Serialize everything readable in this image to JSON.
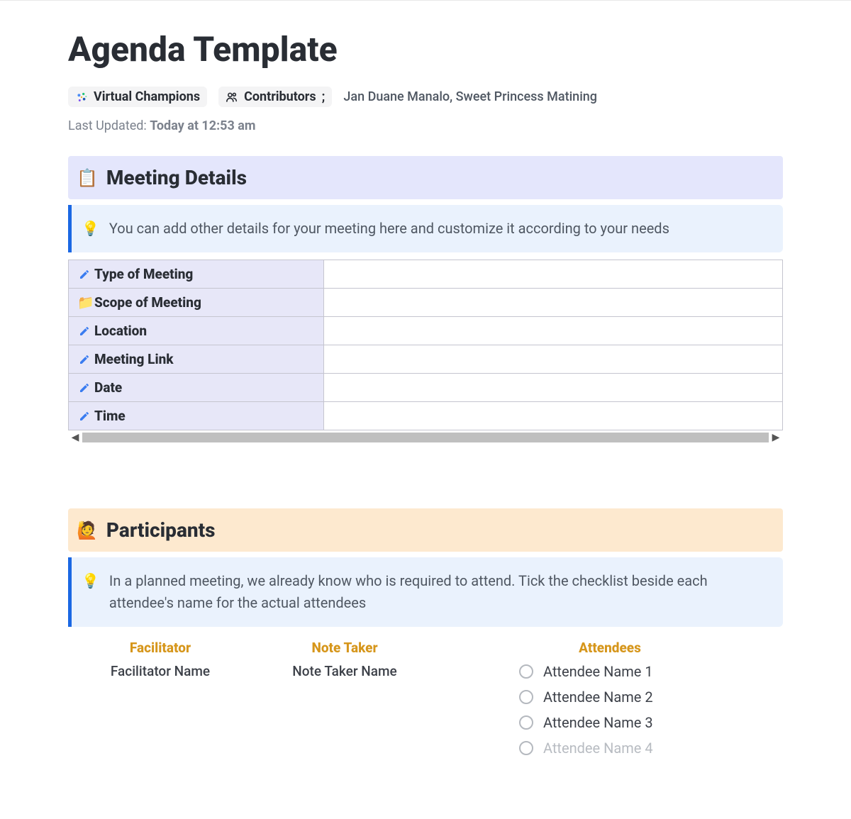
{
  "header": {
    "title": "Agenda Template",
    "org": "Virtual Champions",
    "contributors_label": "Contributors",
    "contributors_sep": ";",
    "contributors_names": "Jan Duane Manalo, Sweet Princess Matining",
    "last_updated_label": "Last Updated:",
    "last_updated_value": "Today at 12:53 am"
  },
  "meeting_details": {
    "title": "Meeting Details",
    "callout": "You can add other details for your meeting here and customize it according to your needs",
    "rows": [
      {
        "icon": "pencil",
        "label": "Type of Meeting",
        "value": ""
      },
      {
        "icon": "folder",
        "label": "Scope of Meeting",
        "value": ""
      },
      {
        "icon": "pencil",
        "label": "Location",
        "value": ""
      },
      {
        "icon": "pencil",
        "label": "Meeting Link",
        "value": ""
      },
      {
        "icon": "pencil",
        "label": "Date",
        "value": ""
      },
      {
        "icon": "pencil",
        "label": "Time",
        "value": ""
      }
    ]
  },
  "participants": {
    "title": "Participants",
    "callout": "In a planned meeting, we already know who is required to attend. Tick the checklist beside each attendee's name for the actual attendees",
    "facilitator_label": "Facilitator",
    "facilitator_value": "Facilitator Name",
    "notetaker_label": "Note Taker",
    "notetaker_value": "Note Taker Name",
    "attendees_label": "Attendees",
    "attendees": [
      "Attendee Name 1",
      "Attendee Name 2",
      "Attendee Name 3",
      "Attendee Name 4"
    ]
  },
  "icons": {
    "org_logo": "⚙",
    "contributors": "👥",
    "notepad": "📋",
    "bulb": "💡",
    "folder": "📁",
    "raised_hand": "🙋"
  }
}
